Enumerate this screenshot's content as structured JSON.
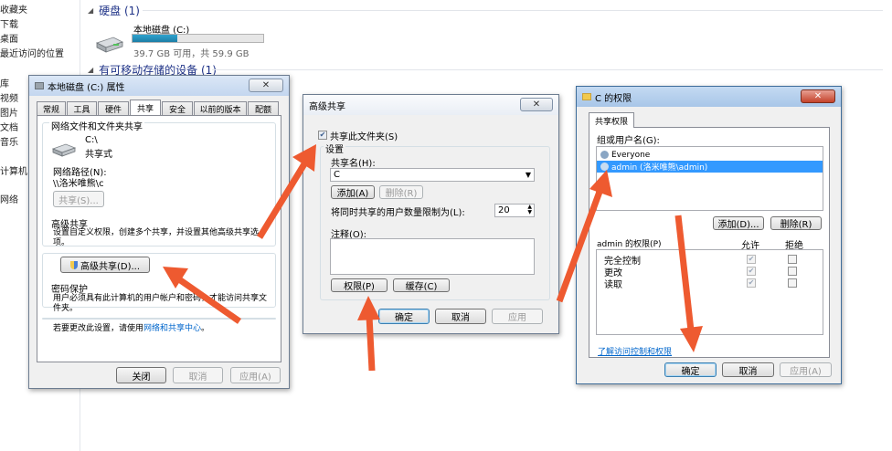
{
  "explorer": {
    "sidebar_items": [
      "收藏夹",
      "下载",
      "桌面",
      "最近访问的位置",
      "库",
      "视频",
      "图片",
      "文档",
      "音乐",
      "计算机",
      "网络"
    ],
    "hard_disk_group": "硬盘 (1)",
    "removable_group": "有可移动存储的设备 (1)",
    "drive": {
      "name": "本地磁盘 (C:)",
      "free": "39.7 GB 可用，共 59.9 GB",
      "used_fraction": 0.34
    }
  },
  "properties": {
    "title": "本地磁盘 (C:) 属性",
    "close": "✕",
    "tabs_top": [
      "常规",
      "工具",
      "硬件",
      "共享",
      "安全",
      "以前的版本",
      "配额"
    ],
    "active_tab": "共享",
    "section_network": "网络文件和文件夹共享",
    "share_path_short": "C:\\",
    "share_state": "共享式",
    "net_path_label": "网络路径(N):",
    "net_path_value": "\\\\洛米唯熊\\c",
    "share_button": "共享(S)...",
    "section_advanced": "高级共享",
    "advanced_desc": "设置自定义权限，创建多个共享，并设置其他高级共享选项。",
    "advanced_button": "高级共享(D)...",
    "section_password": "密码保护",
    "password_desc": "用户必须具有此计算机的用户帐户和密码，才能访问共享文件夹。",
    "password_change_text": "若要更改此设置，请使用",
    "password_link": "网络和共享中心",
    "password_period": "。",
    "btn_close": "关闭",
    "btn_cancel": "取消",
    "btn_apply": "应用(A)"
  },
  "advanced": {
    "title": "高级共享",
    "close": "✕",
    "share_checkbox": "共享此文件夹(S)",
    "settings_label": "设置",
    "share_name_label": "共享名(H):",
    "share_name_value": "C",
    "add_button": "添加(A)",
    "delete_button": "删除(R)",
    "limit_label": "将同时共享的用户数量限制为(L):",
    "limit_value": "20",
    "comment_label": "注释(O):",
    "permissions_button": "权限(P)",
    "cache_button": "缓存(C)",
    "ok": "确定",
    "cancel": "取消",
    "apply": "应用"
  },
  "perms": {
    "title": "C 的权限",
    "close": "✕",
    "tab": "共享权限",
    "group_label": "组或用户名(G):",
    "users": [
      "Everyone",
      "admin (洛米唯熊\\admin)"
    ],
    "add_button": "添加(D)...",
    "delete_button": "删除(R)",
    "perm_for": "admin 的权限(P)",
    "allow": "允许",
    "deny": "拒绝",
    "rows": [
      "完全控制",
      "更改",
      "读取"
    ],
    "link": "了解访问控制和权限",
    "ok": "确定",
    "cancel": "取消",
    "apply": "应用(A)"
  },
  "colors": {
    "arrow": "#ee5a30",
    "selection": "#3399ff",
    "link": "#0066cc"
  }
}
